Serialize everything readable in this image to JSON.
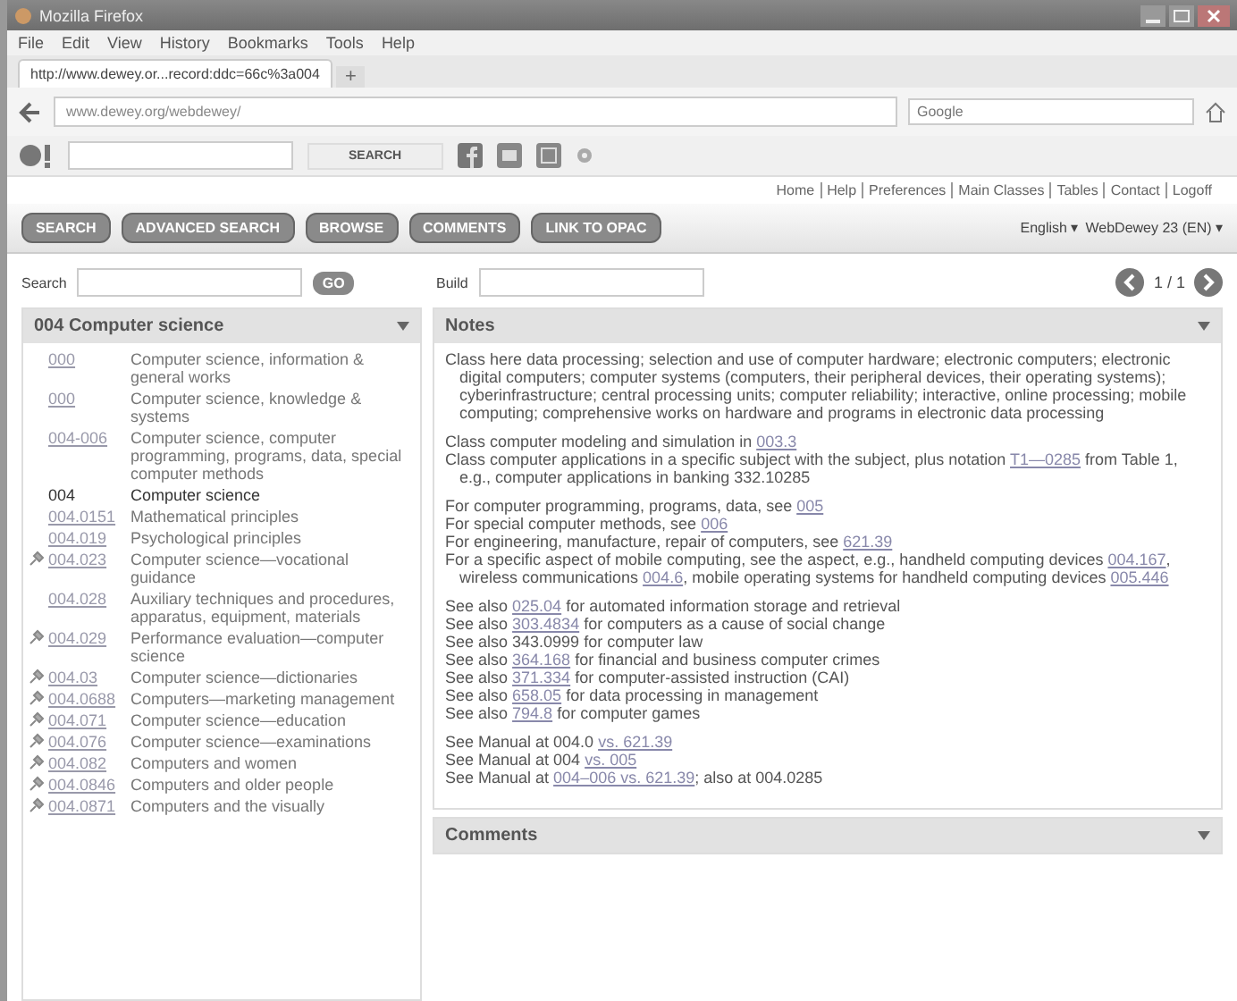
{
  "window": {
    "title": "Mozilla Firefox"
  },
  "menu": [
    "File",
    "Edit",
    "View",
    "History",
    "Bookmarks",
    "Tools",
    "Help"
  ],
  "tab": {
    "title": "http://www.dewey.or...record:ddc=66c%3a004",
    "new_tab": "+"
  },
  "address": {
    "url": "www.dewey.org/webdewey/",
    "search_placeholder": "Google"
  },
  "toolbar": {
    "search_button": "SEARCH"
  },
  "top_links": [
    "Home",
    "Help",
    "Preferences",
    "Main Classes",
    "Tables",
    "Contact",
    "Logoff"
  ],
  "nav_buttons": [
    "SEARCH",
    "ADVANCED SEARCH",
    "BROWSE",
    "COMMENTS",
    "LINK TO OPAC"
  ],
  "selectors": [
    "English ▾",
    "WebDewey 23 (EN) ▾"
  ],
  "search": {
    "label": "Search",
    "go": "GO"
  },
  "build": {
    "label": "Build",
    "pager": "1 / 1"
  },
  "hierarchy": {
    "title": "004 Computer science",
    "entries": [
      {
        "number": "000",
        "text": "Computer science, information & general works",
        "pinned": false,
        "current": false
      },
      {
        "number": "000",
        "text": "Computer science, knowledge & systems",
        "pinned": false,
        "current": false
      },
      {
        "number": "004-006",
        "text": "Computer science, computer programming, programs, data, special computer methods",
        "pinned": false,
        "current": false
      },
      {
        "number": "004",
        "text": "Computer science",
        "pinned": false,
        "current": true
      },
      {
        "number": "004.0151",
        "text": "Mathematical principles",
        "pinned": false,
        "current": false
      },
      {
        "number": "004.019",
        "text": "Psychological principles",
        "pinned": false,
        "current": false
      },
      {
        "number": "004.023",
        "text": "Computer science—vocational guidance",
        "pinned": true,
        "current": false
      },
      {
        "number": "004.028",
        "text": "Auxiliary techniques and procedures, apparatus, equipment, materials",
        "pinned": false,
        "current": false
      },
      {
        "number": "004.029",
        "text": "Performance evaluation—computer science",
        "pinned": true,
        "current": false
      },
      {
        "number": "004.03",
        "text": "Computer science—dictionaries",
        "pinned": true,
        "current": false
      },
      {
        "number": "004.0688",
        "text": "Computers—marketing management",
        "pinned": true,
        "current": false
      },
      {
        "number": "004.071",
        "text": "Computer science—education",
        "pinned": true,
        "current": false
      },
      {
        "number": "004.076",
        "text": "Computer science—examinations",
        "pinned": true,
        "current": false
      },
      {
        "number": "004.082",
        "text": "Computers and women",
        "pinned": true,
        "current": false
      },
      {
        "number": "004.0846",
        "text": "Computers and older people",
        "pinned": true,
        "current": false
      },
      {
        "number": "004.0871",
        "text": "Computers and the visually",
        "pinned": true,
        "current": false
      }
    ]
  },
  "notes": {
    "title": "Notes",
    "groups": [
      [
        [
          {
            "t": "Class here data processing; selection and use of computer hardware; electronic computers; electronic digital computers; computer systems (computers, their peripheral devices, their operating systems); cyberinfrastructure; central processing units; computer reliability; interactive, online processing; mobile computing; comprehensive works on hardware and programs in electronic data processing",
            "link": false
          }
        ]
      ],
      [
        [
          {
            "t": "Class computer modeling and simulation in ",
            "link": false
          },
          {
            "t": "003.3",
            "link": true
          }
        ],
        [
          {
            "t": "Class computer applications in a specific subject with the subject, plus notation ",
            "link": false
          },
          {
            "t": "T1—0285",
            "link": true
          },
          {
            "t": " from Table 1, e.g., computer applications in banking 332.10285",
            "link": false
          }
        ]
      ],
      [
        [
          {
            "t": "For computer programming, programs, data, see ",
            "link": false
          },
          {
            "t": "005",
            "link": true
          }
        ],
        [
          {
            "t": "For special computer methods, see ",
            "link": false
          },
          {
            "t": "006",
            "link": true
          }
        ],
        [
          {
            "t": "For engineering, manufacture, repair of computers, see ",
            "link": false
          },
          {
            "t": "621.39",
            "link": true
          }
        ],
        [
          {
            "t": "For a specific aspect of mobile computing, see the aspect, e.g., handheld computing devices ",
            "link": false
          },
          {
            "t": "004.167",
            "link": true
          },
          {
            "t": ", wireless communications ",
            "link": false
          },
          {
            "t": "004.6",
            "link": true
          },
          {
            "t": ", mobile operating systems for handheld computing devices ",
            "link": false
          },
          {
            "t": "005.446",
            "link": true
          }
        ]
      ],
      [
        [
          {
            "t": "See also ",
            "link": false
          },
          {
            "t": "025.04",
            "link": true
          },
          {
            "t": " for automated information storage and retrieval",
            "link": false
          }
        ],
        [
          {
            "t": "See also ",
            "link": false
          },
          {
            "t": "303.4834",
            "link": true
          },
          {
            "t": " for computers as a cause of social change",
            "link": false
          }
        ],
        [
          {
            "t": "See also 343.0999 for computer law",
            "link": false
          }
        ],
        [
          {
            "t": "See also ",
            "link": false
          },
          {
            "t": "364.168",
            "link": true
          },
          {
            "t": " for financial and business computer crimes",
            "link": false
          }
        ],
        [
          {
            "t": "See also ",
            "link": false
          },
          {
            "t": "371.334",
            "link": true
          },
          {
            "t": " for computer-assisted instruction (CAI)",
            "link": false
          }
        ],
        [
          {
            "t": "See also ",
            "link": false
          },
          {
            "t": "658.05",
            "link": true
          },
          {
            "t": " for data processing in management",
            "link": false
          }
        ],
        [
          {
            "t": "See also ",
            "link": false
          },
          {
            "t": "794.8",
            "link": true
          },
          {
            "t": " for computer games",
            "link": false
          }
        ]
      ],
      [
        [
          {
            "t": "See Manual at 004.0 ",
            "link": false
          },
          {
            "t": "vs. 621.39",
            "link": true
          }
        ],
        [
          {
            "t": "See Manual at 004 ",
            "link": false
          },
          {
            "t": "vs. 005",
            "link": true
          }
        ],
        [
          {
            "t": "See Manual at ",
            "link": false
          },
          {
            "t": "004–006 vs. 621.39",
            "link": true
          },
          {
            "t": "; also at 004.0285",
            "link": false
          }
        ]
      ]
    ]
  },
  "comments": {
    "title": "Comments"
  }
}
